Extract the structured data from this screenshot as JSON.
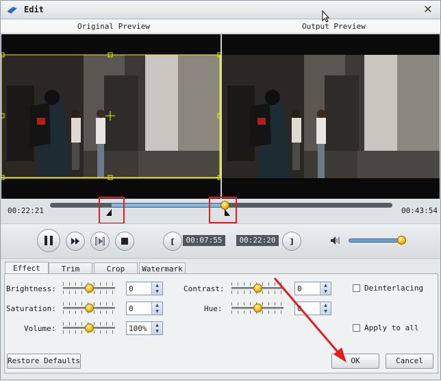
{
  "window": {
    "title": "Edit"
  },
  "previews": {
    "original_label": "Original Preview",
    "output_label": "Output Preview"
  },
  "timeline": {
    "start_time": "00:22:21",
    "end_time": "00:43:54",
    "trim_start": "00:07:55",
    "trim_end": "00:22:20",
    "trim_start_fraction": 0.18,
    "trim_end_fraction": 0.51
  },
  "controls": {
    "volume_fraction": 0.92
  },
  "tabs": [
    "Effect",
    "Trim",
    "Crop",
    "Watermark"
  ],
  "active_tab": "Effect",
  "effect": {
    "brightness": {
      "label": "Brightness:",
      "value": "0",
      "level": 0.5
    },
    "saturation": {
      "label": "Saturation:",
      "value": "0",
      "level": 0.5
    },
    "volume": {
      "label": "Volume:",
      "value": "100%",
      "level": 0.5
    },
    "contrast": {
      "label": "Contrast:",
      "value": "0",
      "level": 0.5
    },
    "hue": {
      "label": "Hue:",
      "value": "0",
      "level": 0.5
    },
    "deinterlacing": {
      "label": "Deinterlacing",
      "checked": false
    },
    "apply_to_all": {
      "label": "Apply to all",
      "checked": false
    }
  },
  "buttons": {
    "restore_defaults": "Restore Defaults",
    "ok": "OK",
    "cancel": "Cancel"
  },
  "colors": {
    "accent_knob": "#f0b400",
    "track_fill": "#7fb7e6",
    "highlight": "#e02020",
    "crop_box": "#f2f200"
  }
}
